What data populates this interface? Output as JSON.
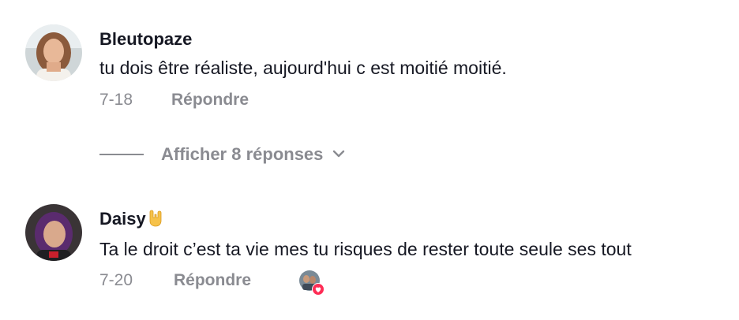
{
  "comments": [
    {
      "username": "Bleutopaze",
      "text": "tu dois être réaliste, aujourd'hui c est moitié moitié.",
      "date": "7-18",
      "reply_label": "Répondre",
      "view_replies_label": "Afficher 8 réponses",
      "avatar_icon": "user-avatar-photo"
    },
    {
      "username": "Daisy",
      "username_emoji": "🤘",
      "text": "Ta le droit c’est ta vie mes tu risques de rester toute seule ses tout",
      "date": "7-20",
      "reply_label": "Répondre",
      "avatar_icon": "user-avatar-photo",
      "liked_by_creator_icon": "creator-liked-heart-icon"
    }
  ],
  "colors": {
    "text_primary": "#161823",
    "text_secondary": "#8a8b91",
    "like_heart": "#fe2c55",
    "background": "#ffffff"
  }
}
